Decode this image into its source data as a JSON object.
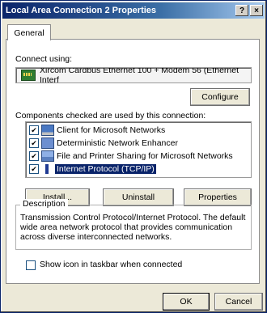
{
  "window": {
    "title": "Local Area Connection 2 Properties",
    "help_button": "?",
    "close_button": "×"
  },
  "tabs": [
    "General"
  ],
  "connect_using": {
    "label": "Connect using:",
    "adapter": "Xircom Cardbus Ethernet 100 + Modem 56 (Ethernet Interf"
  },
  "configure_label": "Configure",
  "components": {
    "label": "Components checked are used by this connection:",
    "items": [
      {
        "label": "Client for Microsoft Networks",
        "checked": true,
        "icon": "network-client-icon"
      },
      {
        "label": "Deterministic Network Enhancer",
        "checked": true,
        "icon": "scheduler-icon"
      },
      {
        "label": "File and Printer Sharing for Microsoft Networks",
        "checked": true,
        "icon": "sharing-icon"
      },
      {
        "label": "Internet Protocol (TCP/IP)",
        "checked": true,
        "icon": "protocol-icon",
        "selected": true
      }
    ]
  },
  "buttons": {
    "install": "Install...",
    "uninstall": "Uninstall",
    "properties": "Properties",
    "ok": "OK",
    "cancel": "Cancel"
  },
  "description": {
    "legend": "Description",
    "text": "Transmission Control Protocol/Internet Protocol. The default wide area network protocol that provides communication across diverse interconnected networks."
  },
  "taskbar_option": {
    "label": "Show icon in taskbar when connected",
    "checked": false
  }
}
